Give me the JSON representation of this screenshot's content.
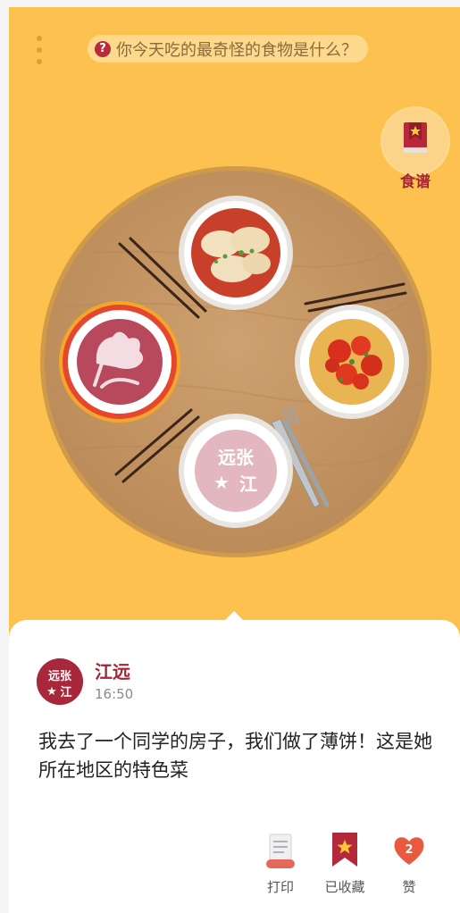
{
  "question": {
    "text": "你今天吃的最奇怪的食物是什么？",
    "icon": "question-mark-icon",
    "icon_glyph": "?"
  },
  "recipe": {
    "label": "食谱",
    "icon": "recipe-book-icon"
  },
  "table": {
    "plates": [
      {
        "name": "dumplings-dish"
      },
      {
        "name": "tomato-egg-dish"
      },
      {
        "name": "stamp-plate",
        "stamp_text": [
          "远张",
          "江"
        ]
      },
      {
        "name": "flower-plate-selected"
      }
    ]
  },
  "post": {
    "user_name": "江远",
    "time": "16:50",
    "avatar_text": [
      "远张",
      "江"
    ],
    "text": "我去了一个同学的房子，我们做了薄饼！这是她所在地区的特色菜"
  },
  "actions": {
    "print": "打印",
    "bookmark": "已收藏",
    "like": "赞",
    "like_count": "2"
  },
  "colors": {
    "background": "#fcc14f",
    "accent": "#a62536",
    "table": "#c79a66"
  }
}
